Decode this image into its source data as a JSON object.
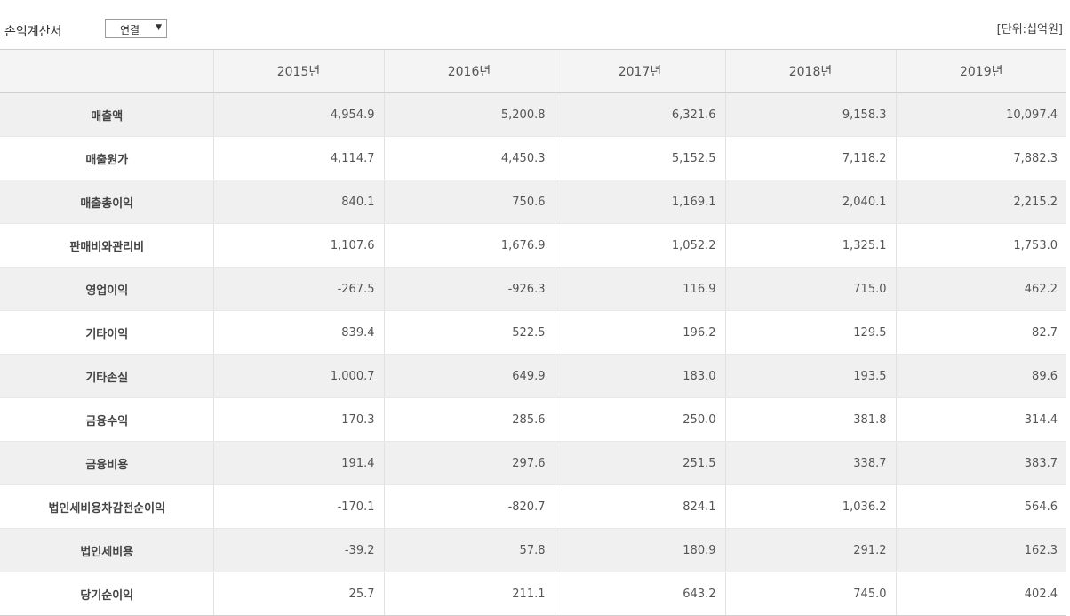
{
  "header": {
    "title": "손익계산서",
    "select_value": "연결",
    "unit": "[단위:십억원]"
  },
  "table": {
    "columns": [
      "2015년",
      "2016년",
      "2017년",
      "2018년",
      "2019년"
    ],
    "rows": [
      {
        "label": "매출액",
        "values": [
          "4,954.9",
          "5,200.8",
          "6,321.6",
          "9,158.3",
          "10,097.4"
        ]
      },
      {
        "label": "매출원가",
        "values": [
          "4,114.7",
          "4,450.3",
          "5,152.5",
          "7,118.2",
          "7,882.3"
        ]
      },
      {
        "label": "매출총이익",
        "values": [
          "840.1",
          "750.6",
          "1,169.1",
          "2,040.1",
          "2,215.2"
        ]
      },
      {
        "label": "판매비와관리비",
        "values": [
          "1,107.6",
          "1,676.9",
          "1,052.2",
          "1,325.1",
          "1,753.0"
        ]
      },
      {
        "label": "영업이익",
        "values": [
          "-267.5",
          "-926.3",
          "116.9",
          "715.0",
          "462.2"
        ]
      },
      {
        "label": "기타이익",
        "values": [
          "839.4",
          "522.5",
          "196.2",
          "129.5",
          "82.7"
        ]
      },
      {
        "label": "기타손실",
        "values": [
          "1,000.7",
          "649.9",
          "183.0",
          "193.5",
          "89.6"
        ]
      },
      {
        "label": "금융수익",
        "values": [
          "170.3",
          "285.6",
          "250.0",
          "381.8",
          "314.4"
        ]
      },
      {
        "label": "금융비용",
        "values": [
          "191.4",
          "297.6",
          "251.5",
          "338.7",
          "383.7"
        ]
      },
      {
        "label": "법인세비용차감전순이익",
        "values": [
          "-170.1",
          "-820.7",
          "824.1",
          "1,036.2",
          "564.6"
        ]
      },
      {
        "label": "법인세비용",
        "values": [
          "-39.2",
          "57.8",
          "180.9",
          "291.2",
          "162.3"
        ]
      },
      {
        "label": "당기순이익",
        "values": [
          "25.7",
          "211.1",
          "643.2",
          "745.0",
          "402.4"
        ]
      }
    ]
  }
}
